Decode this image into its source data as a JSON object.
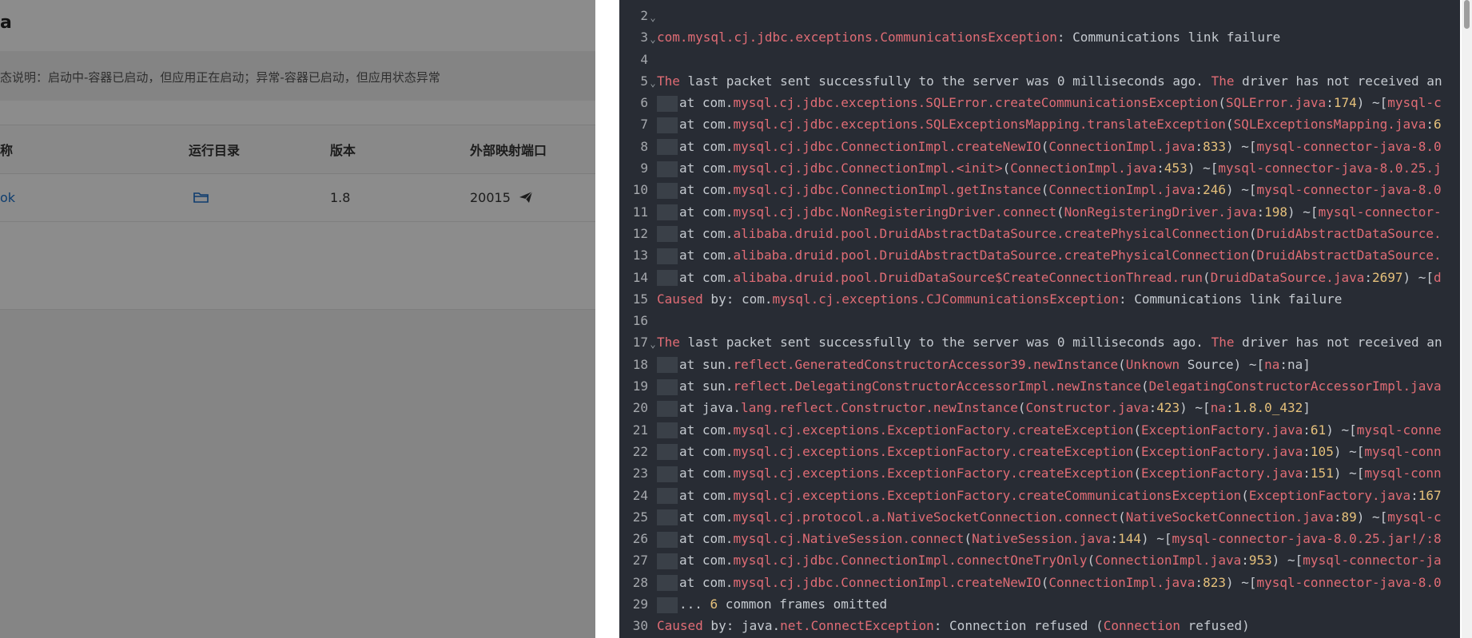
{
  "left": {
    "title": "a",
    "notice": "态说明：启动中-容器已启动，但应用正在启动；异常-容器已启动，但应用状态异常",
    "columns": [
      "称",
      "运行目录",
      "版本",
      "外部映射端口"
    ],
    "row": {
      "name": "ok",
      "version": "1.8",
      "port": "20015"
    },
    "icons": [
      "folder-icon",
      "send-icon"
    ]
  },
  "log": {
    "lines": [
      {
        "n": "2",
        "fold": true,
        "indent": false,
        "parts": []
      },
      {
        "n": "3",
        "fold": true,
        "indent": false,
        "parts": [
          [
            "k",
            "com.mysql.cj.jdbc.exceptions.CommunicationsException"
          ],
          [
            "t",
            ": Communications link failure"
          ]
        ]
      },
      {
        "n": "4",
        "fold": false,
        "indent": false,
        "parts": []
      },
      {
        "n": "5",
        "fold": true,
        "indent": false,
        "parts": [
          [
            "k",
            "The"
          ],
          [
            "t",
            " last packet sent successfully to the server was 0 milliseconds ago. "
          ],
          [
            "k",
            "The"
          ],
          [
            "t",
            " driver has not received an"
          ]
        ]
      },
      {
        "n": "6",
        "fold": false,
        "indent": true,
        "parts": [
          [
            "t",
            "at com."
          ],
          [
            "k",
            "mysql.cj.jdbc.exceptions.SQLError.createCommunicationsException"
          ],
          [
            "t",
            "("
          ],
          [
            "k",
            "SQLError.java"
          ],
          [
            "t",
            ":"
          ],
          [
            "n",
            "174"
          ],
          [
            "t",
            ") ~["
          ],
          [
            "k",
            "mysql-c"
          ]
        ]
      },
      {
        "n": "7",
        "fold": false,
        "indent": true,
        "parts": [
          [
            "t",
            "at com."
          ],
          [
            "k",
            "mysql.cj.jdbc.exceptions.SQLExceptionsMapping.translateException"
          ],
          [
            "t",
            "("
          ],
          [
            "k",
            "SQLExceptionsMapping.java"
          ],
          [
            "t",
            ":"
          ],
          [
            "n",
            "6"
          ]
        ]
      },
      {
        "n": "8",
        "fold": false,
        "indent": true,
        "parts": [
          [
            "t",
            "at com."
          ],
          [
            "k",
            "mysql.cj.jdbc.ConnectionImpl.createNewIO"
          ],
          [
            "t",
            "("
          ],
          [
            "k",
            "ConnectionImpl.java"
          ],
          [
            "t",
            ":"
          ],
          [
            "n",
            "833"
          ],
          [
            "t",
            ") ~["
          ],
          [
            "k",
            "mysql-connector-java-8.0"
          ]
        ]
      },
      {
        "n": "9",
        "fold": false,
        "indent": true,
        "parts": [
          [
            "t",
            "at com."
          ],
          [
            "k",
            "mysql.cj.jdbc.ConnectionImpl.<init>"
          ],
          [
            "t",
            "("
          ],
          [
            "k",
            "ConnectionImpl.java"
          ],
          [
            "t",
            ":"
          ],
          [
            "n",
            "453"
          ],
          [
            "t",
            ") ~["
          ],
          [
            "k",
            "mysql-connector-java-8.0.25.j"
          ]
        ]
      },
      {
        "n": "10",
        "fold": false,
        "indent": true,
        "parts": [
          [
            "t",
            "at com."
          ],
          [
            "k",
            "mysql.cj.jdbc.ConnectionImpl.getInstance"
          ],
          [
            "t",
            "("
          ],
          [
            "k",
            "ConnectionImpl.java"
          ],
          [
            "t",
            ":"
          ],
          [
            "n",
            "246"
          ],
          [
            "t",
            ") ~["
          ],
          [
            "k",
            "mysql-connector-java-8.0"
          ]
        ]
      },
      {
        "n": "11",
        "fold": false,
        "indent": true,
        "parts": [
          [
            "t",
            "at com."
          ],
          [
            "k",
            "mysql.cj.jdbc.NonRegisteringDriver.connect"
          ],
          [
            "t",
            "("
          ],
          [
            "k",
            "NonRegisteringDriver.java"
          ],
          [
            "t",
            ":"
          ],
          [
            "n",
            "198"
          ],
          [
            "t",
            ") ~["
          ],
          [
            "k",
            "mysql-connector-"
          ]
        ]
      },
      {
        "n": "12",
        "fold": false,
        "indent": true,
        "parts": [
          [
            "t",
            "at com."
          ],
          [
            "k",
            "alibaba.druid.pool.DruidAbstractDataSource.createPhysicalConnection"
          ],
          [
            "t",
            "("
          ],
          [
            "k",
            "DruidAbstractDataSource."
          ]
        ]
      },
      {
        "n": "13",
        "fold": false,
        "indent": true,
        "parts": [
          [
            "t",
            "at com."
          ],
          [
            "k",
            "alibaba.druid.pool.DruidAbstractDataSource.createPhysicalConnection"
          ],
          [
            "t",
            "("
          ],
          [
            "k",
            "DruidAbstractDataSource."
          ]
        ]
      },
      {
        "n": "14",
        "fold": false,
        "indent": true,
        "parts": [
          [
            "t",
            "at com."
          ],
          [
            "k",
            "alibaba.druid.pool.DruidDataSource$CreateConnectionThread.run"
          ],
          [
            "t",
            "("
          ],
          [
            "k",
            "DruidDataSource.java"
          ],
          [
            "t",
            ":"
          ],
          [
            "n",
            "2697"
          ],
          [
            "t",
            ") ~["
          ],
          [
            "k",
            "d"
          ]
        ]
      },
      {
        "n": "15",
        "fold": false,
        "indent": false,
        "parts": [
          [
            "k",
            "Caused"
          ],
          [
            "t",
            " by: com."
          ],
          [
            "k",
            "mysql.cj.exceptions.CJCommunicationsException"
          ],
          [
            "t",
            ": Communications link failure"
          ]
        ]
      },
      {
        "n": "16",
        "fold": false,
        "indent": false,
        "parts": []
      },
      {
        "n": "17",
        "fold": true,
        "indent": false,
        "parts": [
          [
            "k",
            "The"
          ],
          [
            "t",
            " last packet sent successfully to the server was 0 milliseconds ago. "
          ],
          [
            "k",
            "The"
          ],
          [
            "t",
            " driver has not received an"
          ]
        ]
      },
      {
        "n": "18",
        "fold": false,
        "indent": true,
        "parts": [
          [
            "t",
            "at sun."
          ],
          [
            "k",
            "reflect.GeneratedConstructorAccessor39.newInstance"
          ],
          [
            "t",
            "("
          ],
          [
            "k",
            "Unknown"
          ],
          [
            "t",
            " Source) ~["
          ],
          [
            "k",
            "na"
          ],
          [
            "t",
            ":na]"
          ]
        ]
      },
      {
        "n": "19",
        "fold": false,
        "indent": true,
        "parts": [
          [
            "t",
            "at sun."
          ],
          [
            "k",
            "reflect.DelegatingConstructorAccessorImpl.newInstance"
          ],
          [
            "t",
            "("
          ],
          [
            "k",
            "DelegatingConstructorAccessorImpl.java"
          ]
        ]
      },
      {
        "n": "20",
        "fold": false,
        "indent": true,
        "parts": [
          [
            "t",
            "at java."
          ],
          [
            "k",
            "lang.reflect.Constructor.newInstance"
          ],
          [
            "t",
            "("
          ],
          [
            "k",
            "Constructor.java"
          ],
          [
            "t",
            ":"
          ],
          [
            "n",
            "423"
          ],
          [
            "t",
            ") ~["
          ],
          [
            "k",
            "na"
          ],
          [
            "t",
            ":"
          ],
          [
            "n",
            "1.8.0_432"
          ],
          [
            "t",
            "]"
          ]
        ]
      },
      {
        "n": "21",
        "fold": false,
        "indent": true,
        "parts": [
          [
            "t",
            "at com."
          ],
          [
            "k",
            "mysql.cj.exceptions.ExceptionFactory.createException"
          ],
          [
            "t",
            "("
          ],
          [
            "k",
            "ExceptionFactory.java"
          ],
          [
            "t",
            ":"
          ],
          [
            "n",
            "61"
          ],
          [
            "t",
            ") ~["
          ],
          [
            "k",
            "mysql-conne"
          ]
        ]
      },
      {
        "n": "22",
        "fold": false,
        "indent": true,
        "parts": [
          [
            "t",
            "at com."
          ],
          [
            "k",
            "mysql.cj.exceptions.ExceptionFactory.createException"
          ],
          [
            "t",
            "("
          ],
          [
            "k",
            "ExceptionFactory.java"
          ],
          [
            "t",
            ":"
          ],
          [
            "n",
            "105"
          ],
          [
            "t",
            ") ~["
          ],
          [
            "k",
            "mysql-conn"
          ]
        ]
      },
      {
        "n": "23",
        "fold": false,
        "indent": true,
        "parts": [
          [
            "t",
            "at com."
          ],
          [
            "k",
            "mysql.cj.exceptions.ExceptionFactory.createException"
          ],
          [
            "t",
            "("
          ],
          [
            "k",
            "ExceptionFactory.java"
          ],
          [
            "t",
            ":"
          ],
          [
            "n",
            "151"
          ],
          [
            "t",
            ") ~["
          ],
          [
            "k",
            "mysql-conn"
          ]
        ]
      },
      {
        "n": "24",
        "fold": false,
        "indent": true,
        "parts": [
          [
            "t",
            "at com."
          ],
          [
            "k",
            "mysql.cj.exceptions.ExceptionFactory.createCommunicationsException"
          ],
          [
            "t",
            "("
          ],
          [
            "k",
            "ExceptionFactory.java"
          ],
          [
            "t",
            ":"
          ],
          [
            "n",
            "167"
          ]
        ]
      },
      {
        "n": "25",
        "fold": false,
        "indent": true,
        "parts": [
          [
            "t",
            "at com."
          ],
          [
            "k",
            "mysql.cj.protocol.a.NativeSocketConnection.connect"
          ],
          [
            "t",
            "("
          ],
          [
            "k",
            "NativeSocketConnection.java"
          ],
          [
            "t",
            ":"
          ],
          [
            "n",
            "89"
          ],
          [
            "t",
            ") ~["
          ],
          [
            "k",
            "mysql-c"
          ]
        ]
      },
      {
        "n": "26",
        "fold": false,
        "indent": true,
        "parts": [
          [
            "t",
            "at com."
          ],
          [
            "k",
            "mysql.cj.NativeSession.connect"
          ],
          [
            "t",
            "("
          ],
          [
            "k",
            "NativeSession.java"
          ],
          [
            "t",
            ":"
          ],
          [
            "n",
            "144"
          ],
          [
            "t",
            ") ~["
          ],
          [
            "k",
            "mysql-connector-java-8.0.25.jar!/:8"
          ]
        ]
      },
      {
        "n": "27",
        "fold": false,
        "indent": true,
        "parts": [
          [
            "t",
            "at com."
          ],
          [
            "k",
            "mysql.cj.jdbc.ConnectionImpl.connectOneTryOnly"
          ],
          [
            "t",
            "("
          ],
          [
            "k",
            "ConnectionImpl.java"
          ],
          [
            "t",
            ":"
          ],
          [
            "n",
            "953"
          ],
          [
            "t",
            ") ~["
          ],
          [
            "k",
            "mysql-connector-ja"
          ]
        ]
      },
      {
        "n": "28",
        "fold": false,
        "indent": true,
        "parts": [
          [
            "t",
            "at com."
          ],
          [
            "k",
            "mysql.cj.jdbc.ConnectionImpl.createNewIO"
          ],
          [
            "t",
            "("
          ],
          [
            "k",
            "ConnectionImpl.java"
          ],
          [
            "t",
            ":"
          ],
          [
            "n",
            "823"
          ],
          [
            "t",
            ") ~["
          ],
          [
            "k",
            "mysql-connector-java-8.0"
          ]
        ]
      },
      {
        "n": "29",
        "fold": false,
        "indent": true,
        "parts": [
          [
            "t",
            "... "
          ],
          [
            "n",
            "6"
          ],
          [
            "t",
            " common frames omitted"
          ]
        ]
      },
      {
        "n": "30",
        "fold": false,
        "indent": false,
        "parts": [
          [
            "k",
            "Caused"
          ],
          [
            "t",
            " by: java."
          ],
          [
            "k",
            "net.ConnectException"
          ],
          [
            "t",
            ": Connection refused ("
          ],
          [
            "k",
            "Connection"
          ],
          [
            "t",
            " refused)"
          ]
        ]
      }
    ]
  },
  "colors": {
    "log_bg": "#282c34",
    "keyword": "#e06c75",
    "number": "#e5c07b",
    "text": "#c5cad0",
    "link": "#1a6fc9"
  }
}
